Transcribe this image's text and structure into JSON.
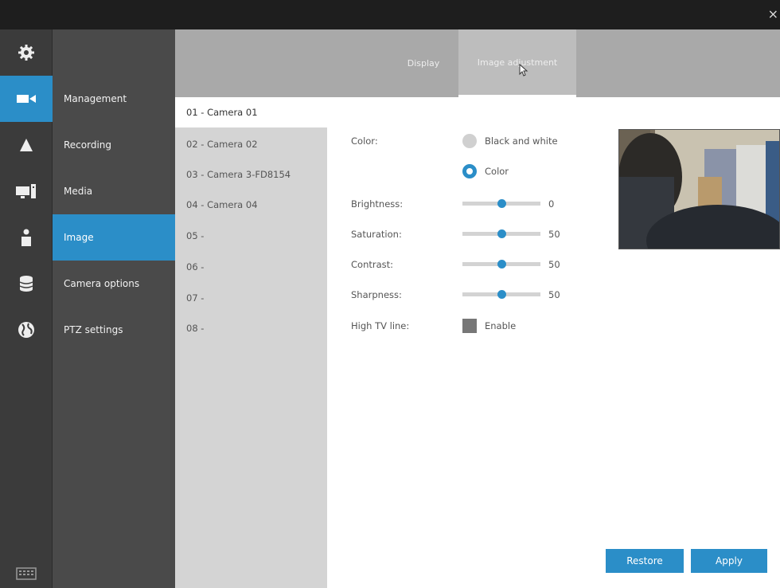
{
  "window": {
    "close_glyph": "×"
  },
  "iconbar": {
    "items": [
      {
        "icon": "gear-icon"
      },
      {
        "icon": "camera-icon",
        "active": true
      },
      {
        "icon": "alert-icon"
      },
      {
        "icon": "monitor-icon"
      },
      {
        "icon": "user-icon"
      },
      {
        "icon": "database-icon"
      },
      {
        "icon": "globe-icon"
      }
    ],
    "bottom_icon": "keyboard-icon"
  },
  "menu": {
    "items": [
      {
        "label": "Management"
      },
      {
        "label": "Recording"
      },
      {
        "label": "Media"
      },
      {
        "label": "Image",
        "active": true
      },
      {
        "label": "Camera options"
      },
      {
        "label": "PTZ settings"
      }
    ]
  },
  "tabs": [
    {
      "label": "Display"
    },
    {
      "label": "Image adjustment",
      "active": true
    }
  ],
  "cameras": [
    {
      "label": "01 - Camera 01",
      "active": true
    },
    {
      "label": "02 - Camera 02"
    },
    {
      "label": "03 - Camera 3-FD8154"
    },
    {
      "label": "04 - Camera 04"
    },
    {
      "label": "05 -"
    },
    {
      "label": "06 -"
    },
    {
      "label": "07 -"
    },
    {
      "label": "08 -"
    }
  ],
  "settings": {
    "color": {
      "label": "Color:",
      "options": [
        {
          "label": "Black and white",
          "selected": false
        },
        {
          "label": "Color",
          "selected": true
        }
      ]
    },
    "sliders": [
      {
        "label": "Brightness:",
        "value": "0",
        "min": -100,
        "max": 100
      },
      {
        "label": "Saturation:",
        "value": "50",
        "min": 0,
        "max": 100
      },
      {
        "label": "Contrast:",
        "value": "50",
        "min": 0,
        "max": 100
      },
      {
        "label": "Sharpness:",
        "value": "50",
        "min": 0,
        "max": 100
      }
    ],
    "high_tv_line": {
      "label": "High TV line:",
      "option_label": "Enable",
      "checked": false
    }
  },
  "buttons": {
    "restore": "Restore",
    "apply": "Apply"
  },
  "colors": {
    "accent": "#2b8ec8",
    "topbar": "#1e1e1e",
    "iconbar": "#3b3b3b",
    "menu": "#4a4a4a",
    "tabbar": "#a9a9a9",
    "camlist": "#d4d4d4"
  }
}
